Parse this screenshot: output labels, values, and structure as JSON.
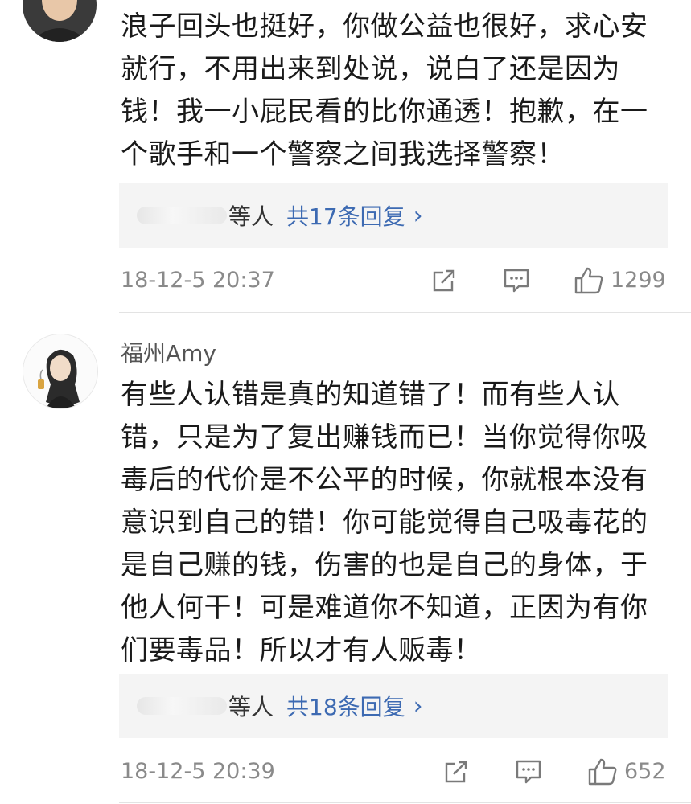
{
  "comments": [
    {
      "body_lines": [
        "浪子回头也挺好，你做公益也很好，求心安",
        "就行，不用出来到处说，说白了还是因为",
        "钱！我一小屁民看的比你通透！抱歉，在一",
        "个歌手和一个警察之间我选择警察！"
      ],
      "reply": {
        "users_suffix": "等人",
        "count_label": "共17条回复",
        "chevron": "›"
      },
      "timestamp": "18-12-5 20:37",
      "likes": "1299"
    },
    {
      "username": "福州Amy",
      "body_lines": [
        "有些人认错是真的知道错了！而有些人认",
        "错，只是为了复出赚钱而已！当你觉得你吸",
        "毒后的代价是不公平的时候，你就根本没有",
        "意识到自己的错！你可能觉得自己吸毒花的",
        "是自己赚的钱，伤害的也是自己的身体，于",
        "他人何干！可是难道你不知道，正因为有你",
        "们要毒品！所以才有人贩毒！"
      ],
      "reply": {
        "users_suffix": "等人",
        "count_label": "共18条回复",
        "chevron": "›"
      },
      "timestamp": "18-12-5 20:39",
      "likes": "652"
    }
  ],
  "icons": {
    "share": "share-icon",
    "comment": "comment-icon",
    "like": "thumbs-up-icon"
  }
}
